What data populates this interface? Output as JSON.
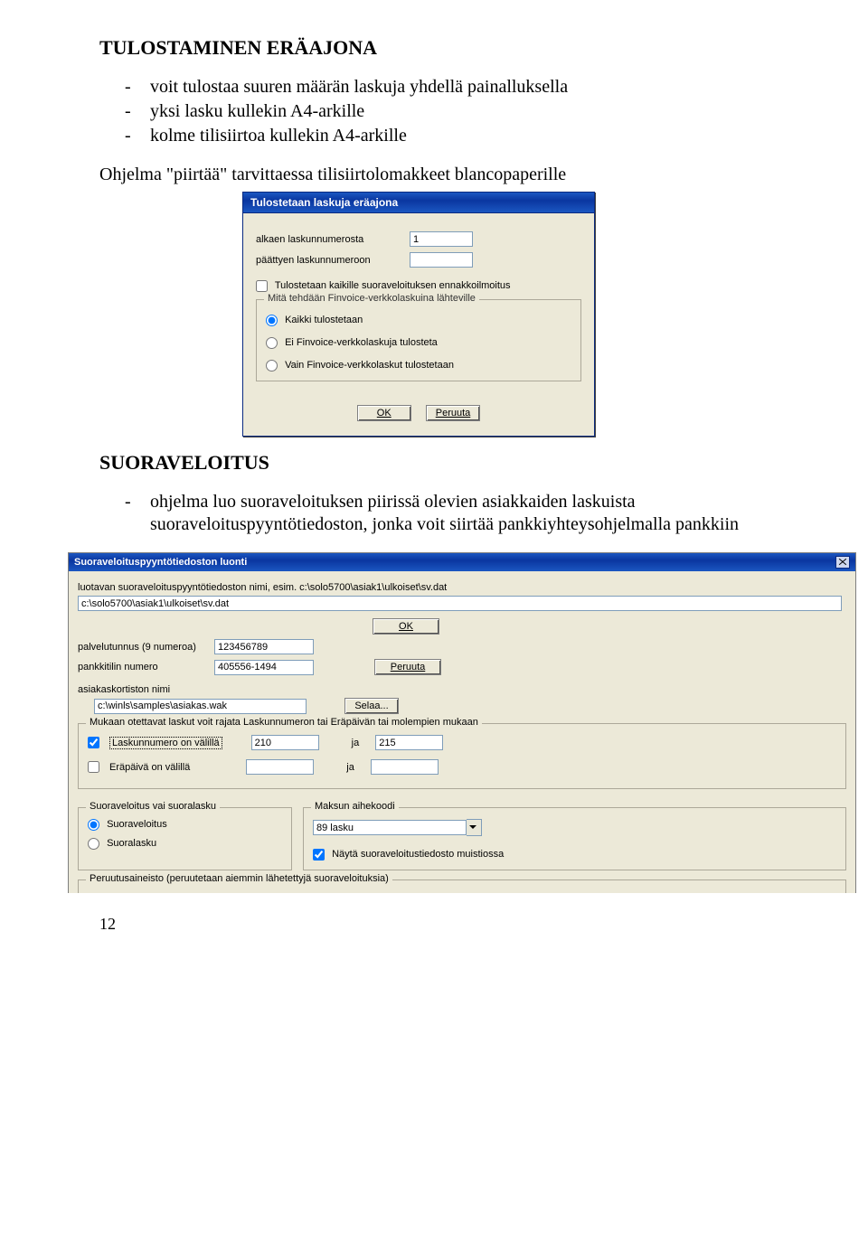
{
  "doc": {
    "h1": "TULOSTAMINEN ERÄAJONA",
    "bullets1": [
      "voit tulostaa suuren määrän laskuja yhdellä painalluksella",
      "yksi lasku kullekin A4-arkille",
      "kolme tilisiirtoa kullekin A4-arkille"
    ],
    "p1": "Ohjelma \"piirtää\" tarvittaessa tilisiirtolomakkeet blancopaperille",
    "h2": "SUORAVELOITUS",
    "bullets2": [
      "ohjelma luo suoraveloituksen piirissä olevien asiakkaiden laskuista suoraveloituspyyntötiedoston, jonka voit siirtää pankkiyhteysohjelmalla pankkiin"
    ],
    "page_number": "12"
  },
  "dlg1": {
    "title": "Tulostetaan laskuja eräajona",
    "start_label": "alkaen laskunnumerosta",
    "start_value": "1",
    "end_label": "päättyen laskunnumeroon",
    "end_value": "",
    "chk_prenotice": "Tulostetaan kaikille suoraveloituksen ennakkoilmoitus",
    "group_title": "Mitä tehdään Finvoice-verkkolaskuina lähteville",
    "opt_all": "Kaikki tulostetaan",
    "opt_no_finvoice": "Ei Finvoice-verkkolaskuja tulosteta",
    "opt_only_finvoice": "Vain Finvoice-verkkolaskut tulostetaan",
    "ok": "OK",
    "cancel": "Peruuta"
  },
  "dlg2": {
    "title": "Suoraveloituspyyntötiedoston luonti",
    "path_label": "luotavan suoraveloituspyyntötiedoston nimi, esim.  c:\\solo5700\\asiak1\\ulkoiset\\sv.dat",
    "path_value": "c:\\solo5700\\asiak1\\ulkoiset\\sv.dat",
    "ok": "OK",
    "service_label": "palvelutunnus (9 numeroa)",
    "service_value": "123456789",
    "bank_label": "pankkitilin numero",
    "bank_value": "405556-1494",
    "cancel": "Peruuta",
    "cardfile_label": "asiakaskortiston nimi",
    "cardfile_value": "c:\\winls\\samples\\asiakas.wak",
    "browse": "Selaa...",
    "filter_legend": "Mukaan otettavat laskut voit rajata Laskunnumeron tai Eräpäivän tai molempien mukaan",
    "filter_num_label": "Laskunnumero on välillä",
    "filter_num_from": "210",
    "and": "ja",
    "filter_num_to": "215",
    "filter_date_label": "Eräpäivä on välillä",
    "filter_date_from": "",
    "filter_date_to": "",
    "mode_legend": "Suoraveloitus vai suoralasku",
    "mode_debit": "Suoraveloitus",
    "mode_invoice": "Suoralasku",
    "reason_legend": "Maksun aihekoodi",
    "reason_value": "89 lasku",
    "show_in_memo": "Näytä suoraveloitustiedosto muistiossa",
    "cancel_material_legend": "Peruutusaineisto (peruutetaan aiemmin lähetettyjä suoraveloituksia)"
  }
}
